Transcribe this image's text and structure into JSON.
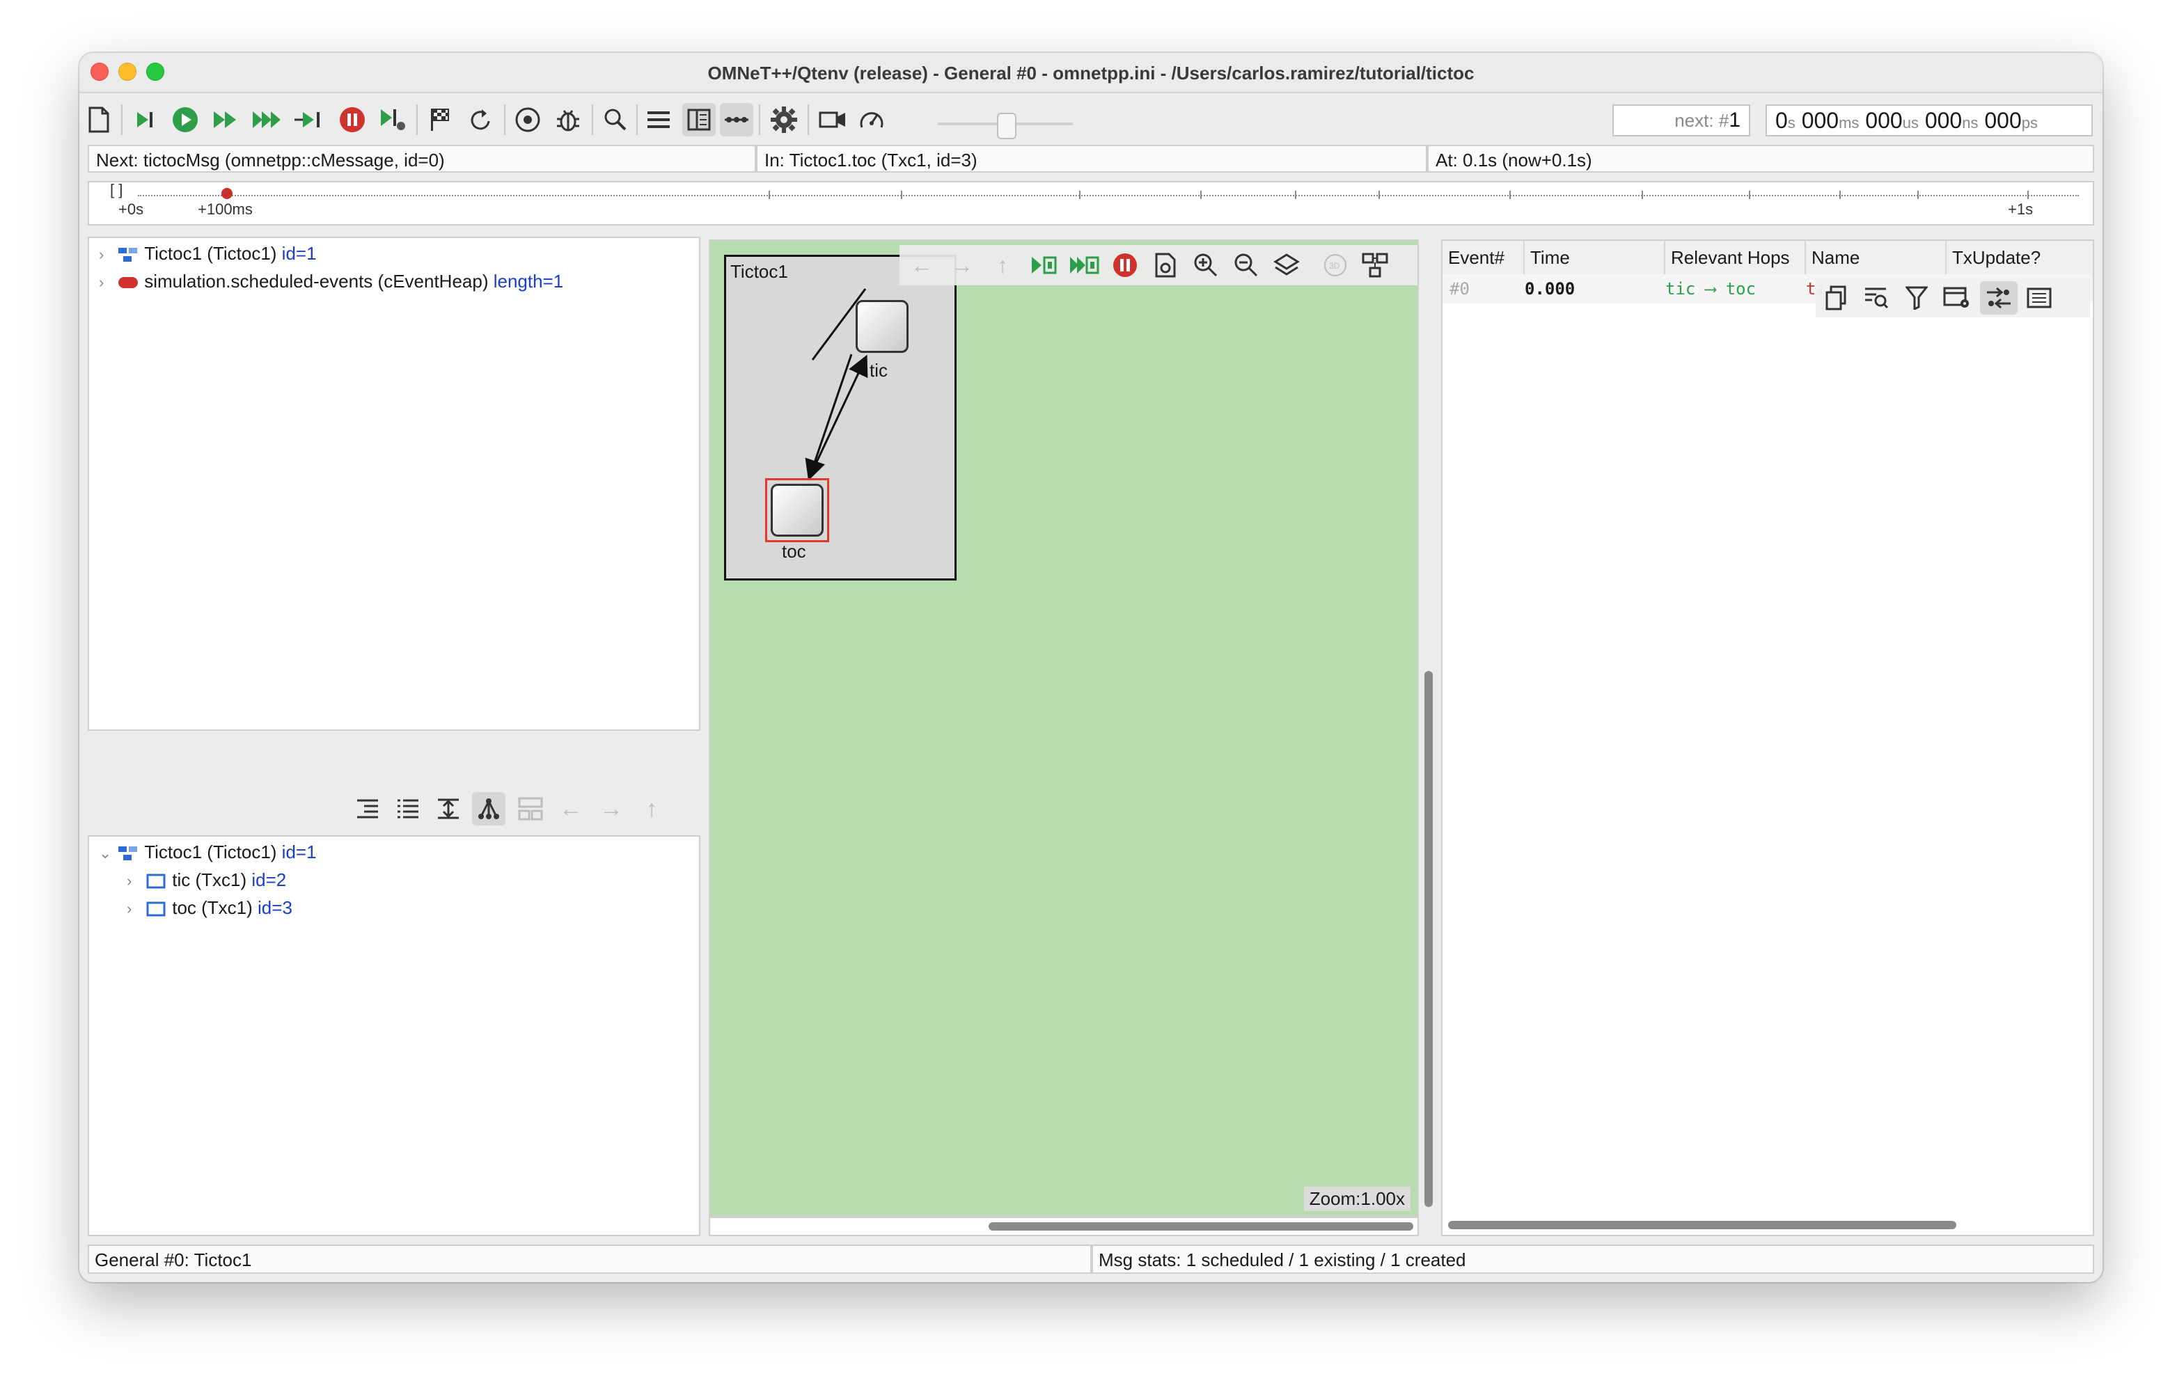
{
  "window": {
    "title": "OMNeT++/Qtenv (release) - General #0 - omnetpp.ini - /Users/carlos.ramirez/tutorial/tictoc"
  },
  "toolbar": {
    "next_prefix": "next: #",
    "next_value": "1",
    "time": {
      "s": "0",
      "s_unit": "s",
      "ms": "000",
      "ms_unit": "ms",
      "us": "000",
      "us_unit": "us",
      "ns": "000",
      "ns_unit": "ns",
      "ps": "000",
      "ps_unit": "ps"
    }
  },
  "infobar": {
    "next": "Next: tictocMsg (omnetpp::cMessage, id=0)",
    "in": "In: Tictoc1.toc (Txc1, id=3)",
    "at": "At: 0.1s (now+0.1s)"
  },
  "timeline": {
    "bracket": "[ ]",
    "label_start": "+0s",
    "label_100ms": "+100ms",
    "label_end": "+1s"
  },
  "object_inspector": {
    "rows": [
      {
        "label": "Tictoc1 (Tictoc1) ",
        "id": "id=1"
      },
      {
        "label": "simulation.scheduled-events (cEventHeap) ",
        "id": "length=1"
      }
    ]
  },
  "module_tree": {
    "rows": [
      {
        "label": "Tictoc1 (Tictoc1) ",
        "id": "id=1"
      },
      {
        "label": "tic (Txc1) ",
        "id": "id=2"
      },
      {
        "label": "toc (Txc1) ",
        "id": "id=3"
      }
    ]
  },
  "network": {
    "title": "Tictoc1",
    "node_tic": "tic",
    "node_toc": "toc",
    "zoom": "Zoom:1.00x"
  },
  "event_log": {
    "columns": [
      "Event#",
      "Time",
      "Relevant Hops",
      "Name",
      "TxUpdate?"
    ],
    "row": {
      "event": "#0",
      "time": "0.000",
      "hops": "tic ⟶ toc",
      "name": "ti"
    }
  },
  "statusbar": {
    "left": "General #0: Tictoc1",
    "right": "Msg stats: 1 scheduled / 1 existing / 1 created"
  },
  "colors": {
    "canvas_bg": "#b7ddae",
    "run_green": "#2e9e4a",
    "stop_red": "#d2322d",
    "link_blue": "#1a3ec8"
  }
}
